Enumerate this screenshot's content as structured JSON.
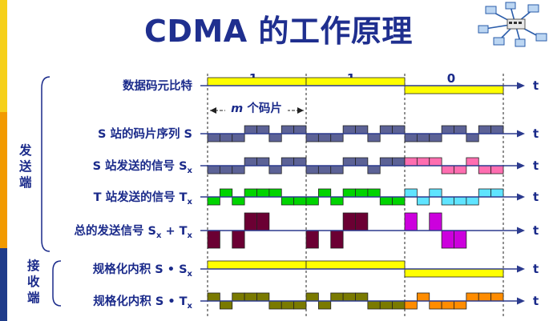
{
  "title": "CDMA 的工作原理",
  "sections": {
    "send": "发送端",
    "receive": "接收端"
  },
  "bit_labels": [
    "1",
    "1",
    "0"
  ],
  "data_bits": [
    1,
    1,
    0
  ],
  "chip_label": "m 个码片",
  "axis_label": "t",
  "rows": [
    {
      "id": "data-bits",
      "label": "数据码元比特",
      "kind": "bits",
      "color": "#ffff00",
      "negColor": "#ffff00"
    },
    {
      "id": "s-chip-seq",
      "label": "S 站的码片序列 S",
      "kind": "chips",
      "chips": [
        -1,
        -1,
        -1,
        1,
        1,
        -1,
        1,
        1
      ],
      "repeat": [
        1,
        1,
        1
      ],
      "color": "#5c6296",
      "negColor": "#5c6296"
    },
    {
      "id": "s-signal",
      "label": "S 站发送的信号 S",
      "sub": "x",
      "kind": "chips",
      "chips": [
        -1,
        -1,
        -1,
        1,
        1,
        -1,
        1,
        1
      ],
      "repeat": [
        1,
        1,
        -1
      ],
      "color": "#5c6296",
      "negColor": "#ff6eb0"
    },
    {
      "id": "t-signal",
      "label": "T 站发送的信号 T",
      "sub": "x",
      "kind": "chips",
      "chips": [
        -1,
        1,
        -1,
        1,
        1,
        1,
        -1,
        -1
      ],
      "repeat": [
        1,
        1,
        -1
      ],
      "color": "#00d400",
      "negColor": "#5fe4ff"
    },
    {
      "id": "sum-signal",
      "label": "总的发送信号 S",
      "sub": "x",
      "label2": " + T",
      "sub2": "x",
      "kind": "sum",
      "color": "#6b0033",
      "negColor": "#cc00dd"
    },
    {
      "id": "inner-s",
      "label": "规格化内积 S • S",
      "sub": "x",
      "kind": "bits",
      "color": "#ffff00",
      "negColor": "#ffff00"
    },
    {
      "id": "inner-t",
      "label": "规格化内积 S • T",
      "sub": "x",
      "kind": "product",
      "color": "#7a7a00",
      "negColor": "#ff8c00"
    }
  ],
  "logo": {
    "name": "network-topology-icon"
  }
}
